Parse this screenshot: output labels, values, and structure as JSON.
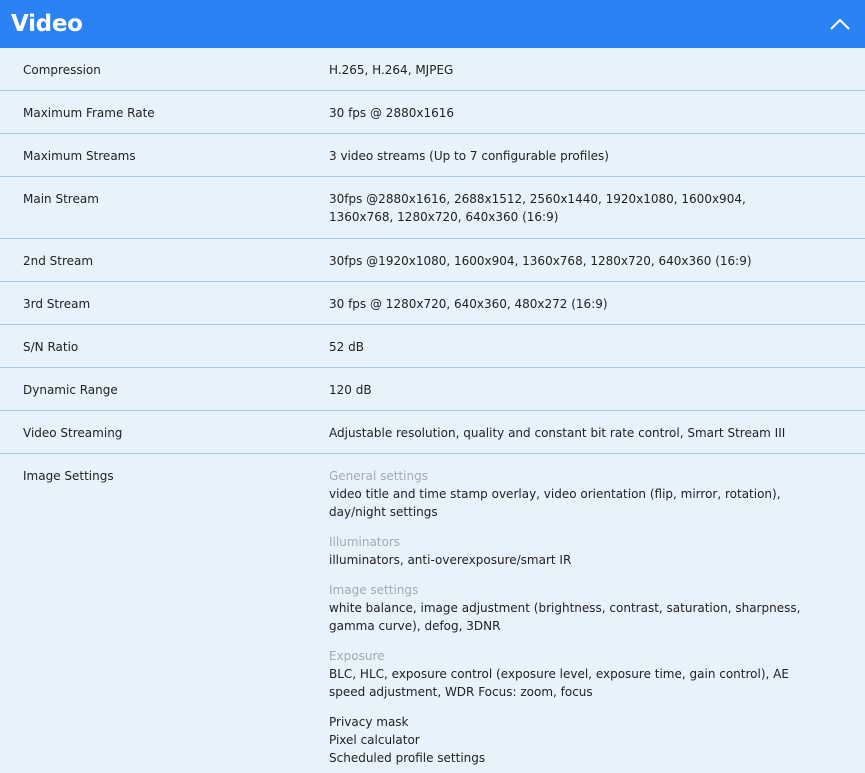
{
  "section": {
    "title": "Video",
    "collapse_icon": "chevron-up-icon",
    "colors": {
      "header_bg": "#2a82f5",
      "body_bg": "#e8f2fc",
      "divider": "#a9c9ec",
      "muted_text": "#a3a9b0"
    }
  },
  "specs": [
    {
      "label": "Compression",
      "value": "H.265, H.264, MJPEG"
    },
    {
      "label": "Maximum Frame Rate",
      "value": "30 fps @ 2880x1616"
    },
    {
      "label": "Maximum Streams",
      "value": "3 video streams (Up to 7 configurable profiles)"
    },
    {
      "label": "Main Stream",
      "value": "30fps @2880x1616, 2688x1512, 2560x1440, 1920x1080, 1600x904, 1360x768, 1280x720, 640x360 (16:9)"
    },
    {
      "label": "2nd Stream",
      "value": "30fps @1920x1080, 1600x904, 1360x768, 1280x720, 640x360 (16:9)"
    },
    {
      "label": "3rd Stream",
      "value": "30 fps @ 1280x720, 640x360, 480x272 (16:9)"
    },
    {
      "label": "S/N Ratio",
      "value": "52 dB"
    },
    {
      "label": "Dynamic Range",
      "value": "120 dB"
    },
    {
      "label": "Video Streaming",
      "value": "Adjustable resolution, quality and constant bit rate control, Smart Stream III"
    }
  ],
  "image_settings": {
    "label": "Image Settings",
    "groups": [
      {
        "title": "General settings",
        "text": "video title and time stamp overlay, video orientation (flip, mirror, rotation), day/night settings"
      },
      {
        "title": "Illuminators",
        "text": "illuminators, anti-overexposure/smart IR"
      },
      {
        "title": "Image settings",
        "text": "white balance, image adjustment (brightness, contrast, saturation, sharpness, gamma curve), defog, 3DNR"
      },
      {
        "title": "Exposure",
        "text": "BLC, HLC, exposure control (exposure level, exposure time, gain control), AE speed adjustment, WDR Focus: zoom, focus"
      }
    ],
    "extra_lines": [
      "Privacy mask",
      "Pixel calculator",
      "Scheduled profile settings"
    ]
  }
}
